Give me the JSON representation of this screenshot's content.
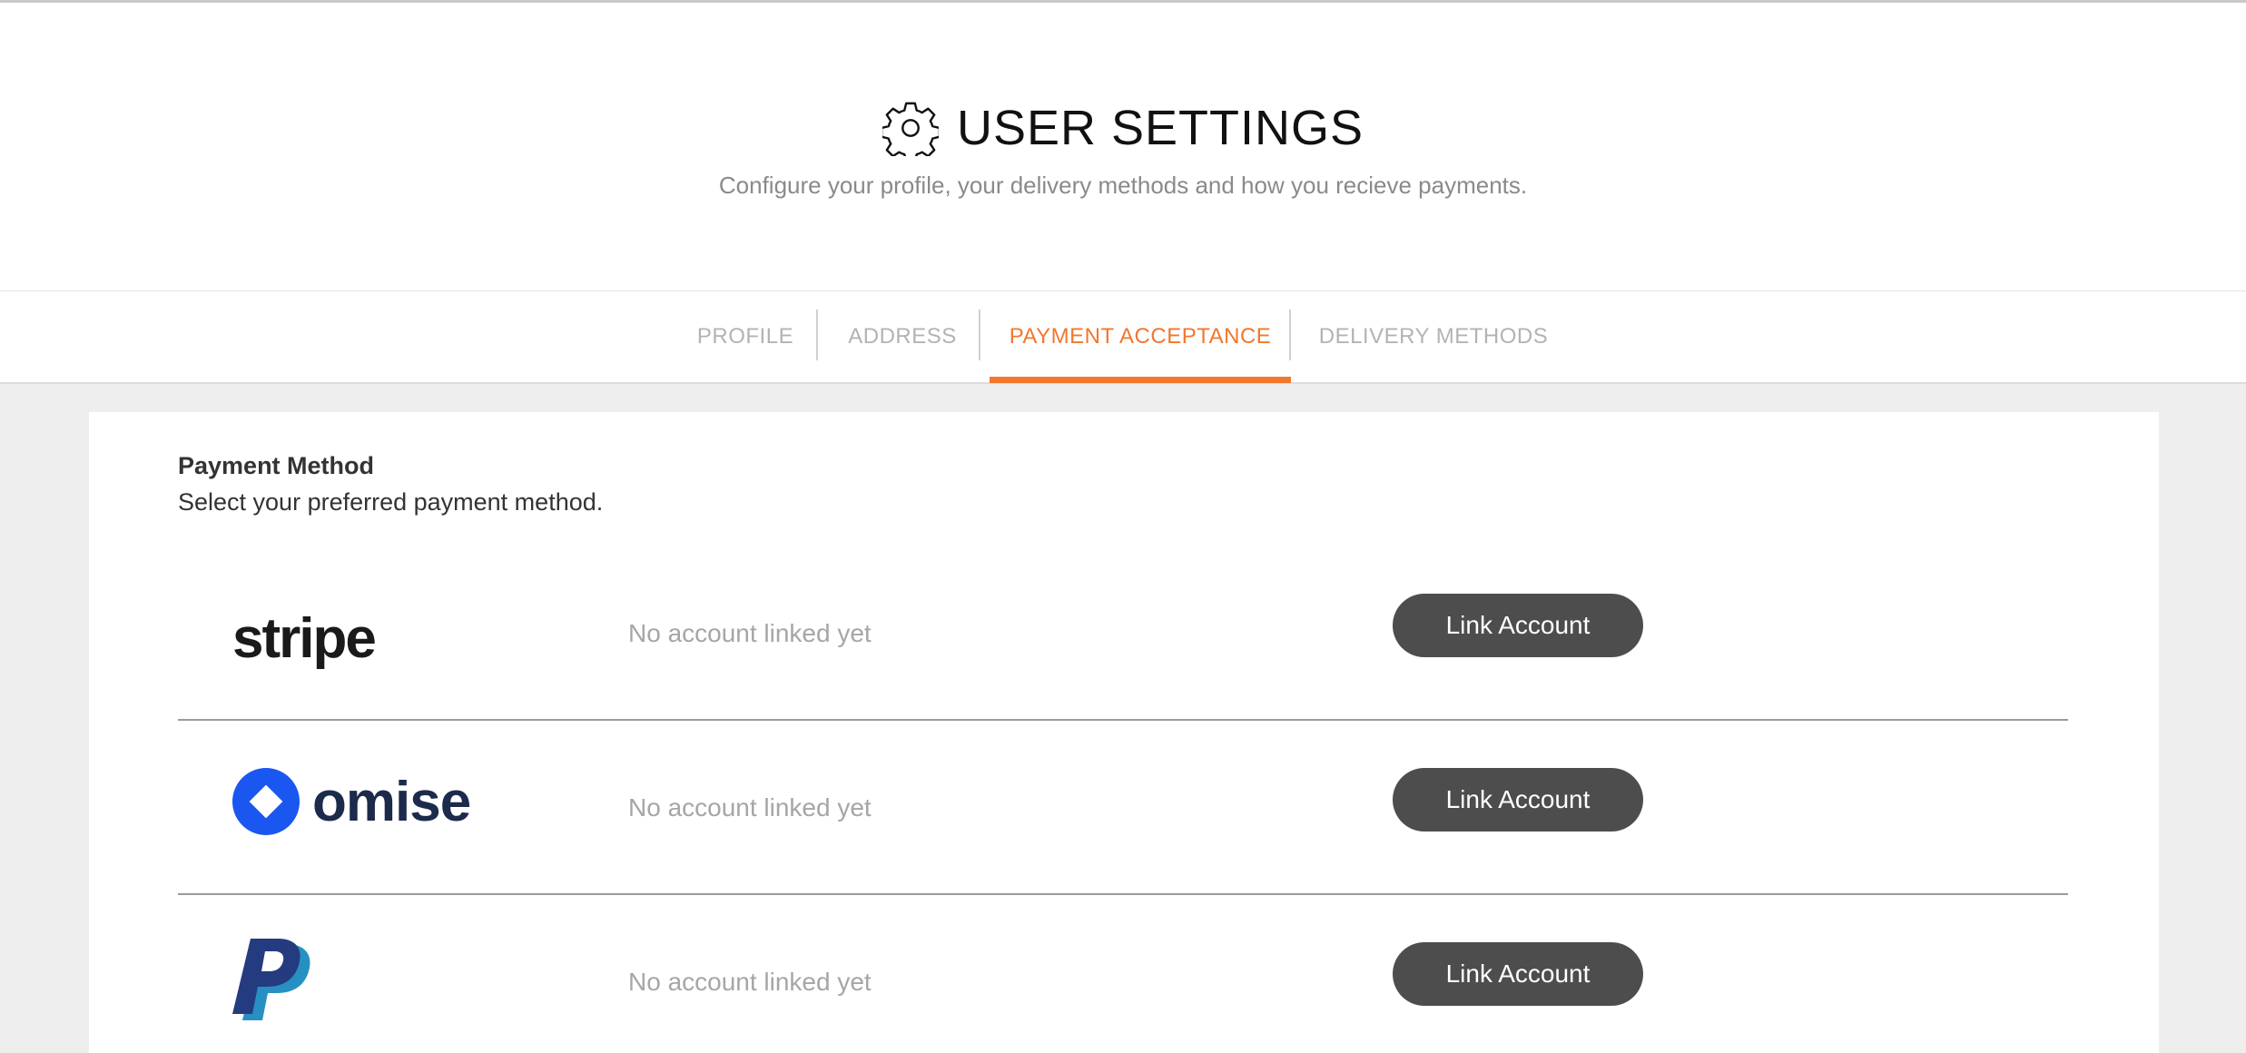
{
  "header": {
    "title": "USER SETTINGS",
    "icon": "gear-icon",
    "subtitle": "Configure your profile, your delivery methods and how you recieve payments."
  },
  "tabs": [
    {
      "label": "PROFILE",
      "active": false
    },
    {
      "label": "ADDRESS",
      "active": false
    },
    {
      "label": "PAYMENT ACCEPTANCE",
      "active": true
    },
    {
      "label": "DELIVERY METHODS",
      "active": false
    }
  ],
  "colors": {
    "accent": "#f0782d",
    "button_bg": "#4d4d4d",
    "muted_text": "#a6a6a6"
  },
  "payment": {
    "section_title": "Payment Method",
    "section_desc": "Select your preferred payment method.",
    "methods": [
      {
        "provider": "stripe",
        "logo_text": "stripe",
        "status": "No account linked yet",
        "button": "Link Account"
      },
      {
        "provider": "omise",
        "logo_text": "omise",
        "status": "No account linked yet",
        "button": "Link Account"
      },
      {
        "provider": "paypal",
        "status": "No account linked yet",
        "button": "Link Account"
      }
    ]
  }
}
